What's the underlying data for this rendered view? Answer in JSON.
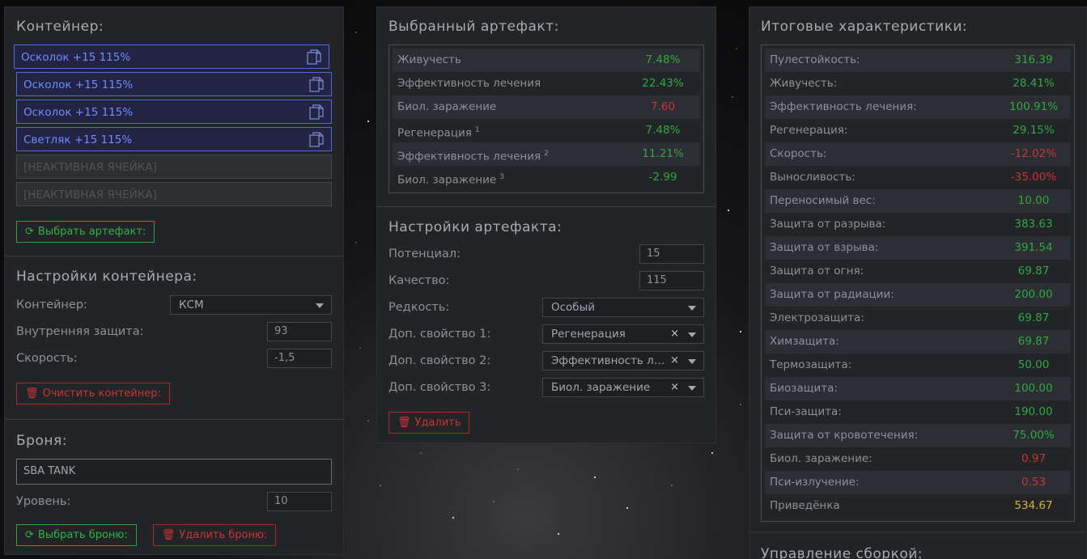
{
  "container": {
    "title": "Контейнер:",
    "slots": [
      {
        "label": "Осколок +15 115%",
        "active": true
      },
      {
        "label": "Осколок +15 115%",
        "active": true
      },
      {
        "label": "Осколок +15 115%",
        "active": true
      },
      {
        "label": "Светляк +15 115%",
        "active": true
      },
      {
        "label": "[НЕАКТИВНАЯ ЯЧЕЙКА]",
        "active": false
      },
      {
        "label": "[НЕАКТИВНАЯ ЯЧЕЙКА]",
        "active": false
      }
    ],
    "select_artifact_button": "Выбрать артефакт:"
  },
  "container_settings": {
    "title": "Настройки контейнера:",
    "container_label": "Контейнер:",
    "container_value": "КСМ",
    "inner_protection_label": "Внутренняя защита:",
    "inner_protection_value": "93",
    "speed_label": "Скорость:",
    "speed_value": "-1,5",
    "clear_button": "Очистить контейнер:"
  },
  "armor": {
    "title": "Броня:",
    "name_value": "SBA TANK",
    "level_label": "Уровень:",
    "level_value": "10",
    "select_button": "Выбрать броню:",
    "delete_button": "Удалить броню:"
  },
  "selected_artifact": {
    "title": "Выбранный артефакт:",
    "stats": [
      {
        "name": "Живучесть",
        "sup": "",
        "value": "7.48%",
        "color": "green"
      },
      {
        "name": "Эффективность лечения",
        "sup": "",
        "value": "22.43%",
        "color": "green"
      },
      {
        "name": "Биол. заражение",
        "sup": "",
        "value": "7.60",
        "color": "red"
      },
      {
        "name": "Регенерация",
        "sup": "1",
        "value": "7.48%",
        "color": "green"
      },
      {
        "name": "Эффективность лечения",
        "sup": "2",
        "value": "11.21%",
        "color": "green"
      },
      {
        "name": "Биол. заражение",
        "sup": "3",
        "value": "-2.99",
        "color": "green"
      }
    ]
  },
  "artifact_settings": {
    "title": "Настройки артефакта:",
    "potential_label": "Потенциал:",
    "potential_value": "15",
    "quality_label": "Качество:",
    "quality_value": "115",
    "rarity_label": "Редкость:",
    "rarity_value": "Особый",
    "extra1_label": "Доп. свойство 1:",
    "extra1_value": "Регенерация",
    "extra2_label": "Доп. свойство 2:",
    "extra2_value": "Эффективность лечения",
    "extra3_label": "Доп. свойство 3:",
    "extra3_value": "Биол. заражение",
    "delete_button": "Удалить"
  },
  "totals": {
    "title": "Итоговые характеристики:",
    "stats": [
      {
        "name": "Пулестойкость:",
        "value": "316.39",
        "color": "green"
      },
      {
        "name": "Живучесть:",
        "value": "28.41%",
        "color": "green"
      },
      {
        "name": "Эффективность лечения:",
        "value": "100.91%",
        "color": "green"
      },
      {
        "name": "Регенерация:",
        "value": "29.15%",
        "color": "green"
      },
      {
        "name": "Скорость:",
        "value": "-12.02%",
        "color": "red"
      },
      {
        "name": "Выносливость:",
        "value": "-35.00%",
        "color": "red"
      },
      {
        "name": "Переносимый вес:",
        "value": "10.00",
        "color": "green"
      },
      {
        "name": "Защита от разрыва:",
        "value": "383.63",
        "color": "green"
      },
      {
        "name": "Защита от взрыва:",
        "value": "391.54",
        "color": "green"
      },
      {
        "name": "Защита от огня:",
        "value": "69.87",
        "color": "green"
      },
      {
        "name": "Защита от радиации:",
        "value": "200.00",
        "color": "green"
      },
      {
        "name": "Электрозащита:",
        "value": "69.87",
        "color": "green"
      },
      {
        "name": "Химзащита:",
        "value": "69.87",
        "color": "green"
      },
      {
        "name": "Термозащита:",
        "value": "50.00",
        "color": "green"
      },
      {
        "name": "Биозащита:",
        "value": "100.00",
        "color": "green"
      },
      {
        "name": "Пси-защита:",
        "value": "190.00",
        "color": "green"
      },
      {
        "name": "Защита от кровотечения:",
        "value": "75.00%",
        "color": "green"
      },
      {
        "name": "Биол. заражение:",
        "value": "0.97",
        "color": "red"
      },
      {
        "name": "Пси-излучение:",
        "value": "0.53",
        "color": "red"
      },
      {
        "name": "Приведёнка",
        "value": "534.67",
        "color": "yellow"
      }
    ]
  },
  "build_management": {
    "title": "Управление сборкой:"
  },
  "colors": {
    "green": "#2fa844",
    "red": "#c93636",
    "yellow": "#d7b23a",
    "slot_accent": "#6d8cff"
  }
}
